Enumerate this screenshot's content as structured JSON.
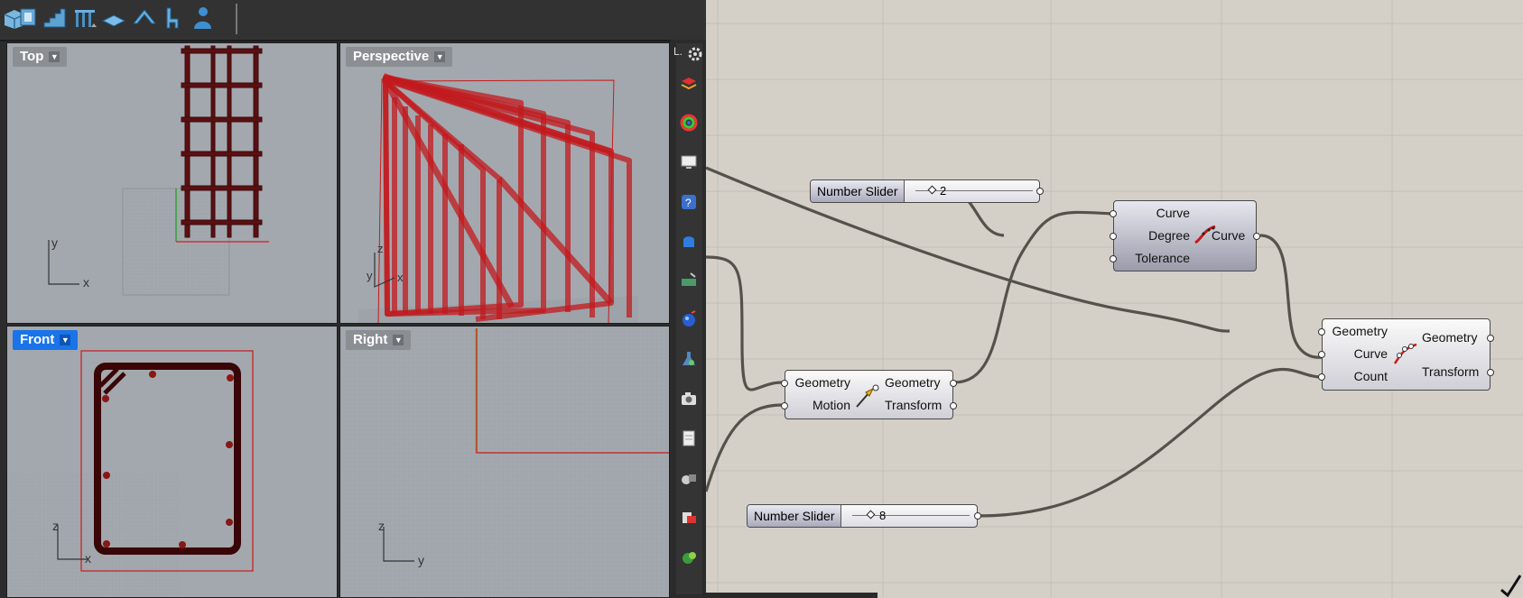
{
  "viewports": {
    "top": {
      "label": "Top",
      "axis_x": "x",
      "axis_y": "y"
    },
    "perspective": {
      "label": "Perspective",
      "axis_z": "z",
      "axis_y": "y",
      "axis_x": "x"
    },
    "front": {
      "label": "Front",
      "axis_z": "z",
      "axis_x": "x"
    },
    "right": {
      "label": "Right",
      "axis_z": "z",
      "axis_y": "y"
    }
  },
  "sidebar": {
    "header": "L."
  },
  "sliders": [
    {
      "label": "Number Slider",
      "value": "2"
    },
    {
      "label": "Number Slider",
      "value": "8"
    }
  ],
  "nodes": {
    "rebuild": {
      "inputs": [
        "Curve",
        "Degree",
        "Tolerance"
      ],
      "outputs": [
        "Curve"
      ]
    },
    "move": {
      "inputs": [
        "Geometry",
        "Motion"
      ],
      "outputs": [
        "Geometry",
        "Transform"
      ]
    },
    "array": {
      "inputs": [
        "Geometry",
        "Curve",
        "Count"
      ],
      "outputs": [
        "Geometry",
        "Transform"
      ]
    }
  },
  "colors": {
    "viewport_bg": "#a3a8ae",
    "active_tab": "#1a73e8",
    "rebar_red": "#c0161c",
    "canvas_bg": "#d4d0c8",
    "wire": "#55524c"
  },
  "icons": {
    "toolbar": [
      "box-icon",
      "wall-icon",
      "stairs-icon",
      "railing-icon",
      "slab-icon",
      "roof-icon",
      "chair-icon",
      "person-icon"
    ],
    "sidebar": [
      "layers-icon",
      "color-wheel-icon",
      "display-icon",
      "help-icon",
      "shape-icon",
      "keyboard-icon",
      "render-icon",
      "flask-icon",
      "camera-icon",
      "document-icon",
      "objects-icon",
      "materials-icon",
      "grasshopper-icon"
    ]
  }
}
